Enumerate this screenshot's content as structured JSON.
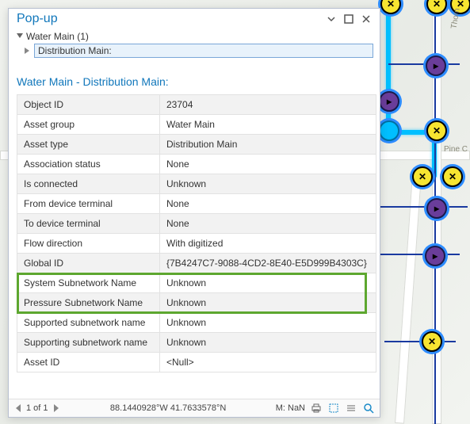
{
  "panel": {
    "title": "Pop-up",
    "tree": {
      "root": "Water Main (1)",
      "selected": "Distribution Main:"
    },
    "section_title": "Water Main - Distribution Main:"
  },
  "attrs": [
    {
      "k": "Object ID",
      "v": "23704"
    },
    {
      "k": "Asset group",
      "v": "Water Main"
    },
    {
      "k": "Asset type",
      "v": "Distribution Main"
    },
    {
      "k": "Association status",
      "v": "None"
    },
    {
      "k": "Is connected",
      "v": "Unknown"
    },
    {
      "k": "From device terminal",
      "v": "None"
    },
    {
      "k": "To device terminal",
      "v": "None"
    },
    {
      "k": "Flow direction",
      "v": "With digitized"
    },
    {
      "k": "Global ID",
      "v": "{7B4247C7-9088-4CD2-8E40-E5D999B4303C}"
    },
    {
      "k": "System Subnetwork Name",
      "v": "Unknown"
    },
    {
      "k": "Pressure Subnetwork Name",
      "v": "Unknown"
    },
    {
      "k": "Supported subnetwork name",
      "v": "Unknown"
    },
    {
      "k": "Supporting subnetwork name",
      "v": "Unknown"
    },
    {
      "k": "Asset ID",
      "v": "<Null>"
    }
  ],
  "highlight": {
    "from_index": 9,
    "to_index": 10
  },
  "footer": {
    "pager": "1 of 1",
    "coords": "88.1440928°W 41.7633578°N",
    "scale": "M: NaN"
  },
  "map": {
    "street1": "Pine C",
    "street2": "Thorn"
  }
}
